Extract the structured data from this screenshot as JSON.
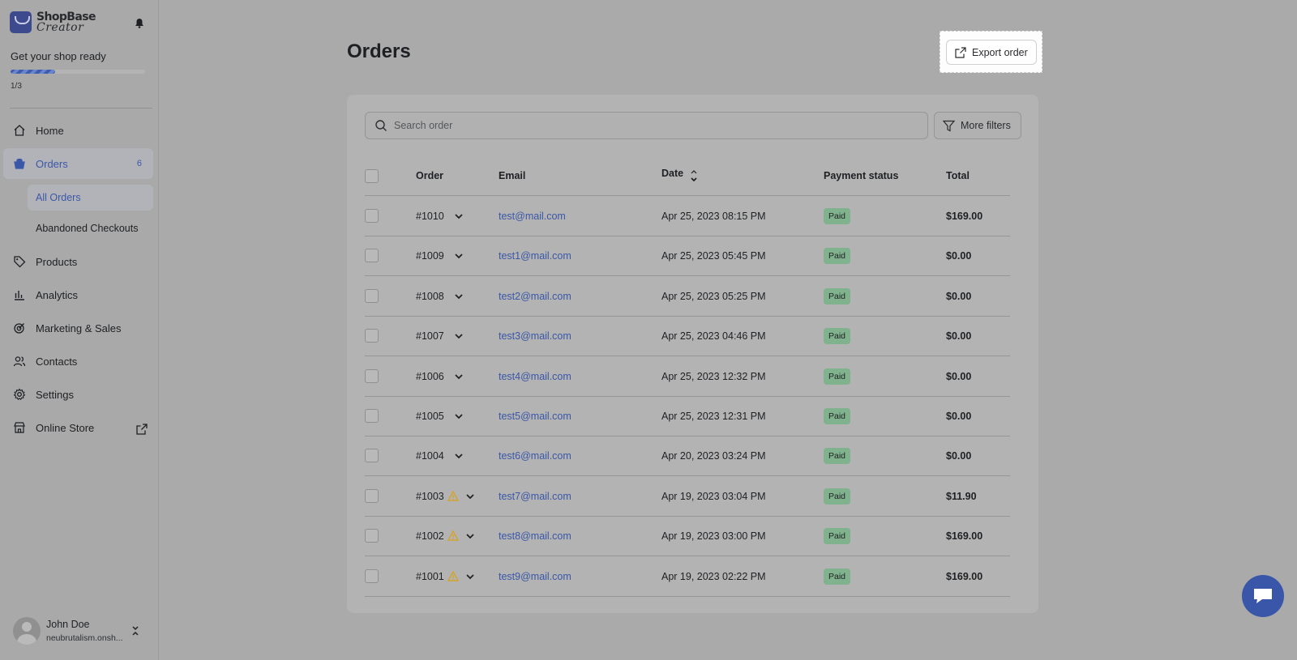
{
  "brand": {
    "line1": "ShopBase",
    "line2": "Creator"
  },
  "setup": {
    "title": "Get your shop ready",
    "progress_text": "1/3",
    "progress_fraction": 0.333
  },
  "nav": {
    "home": "Home",
    "orders": "Orders",
    "orders_badge": "6",
    "all_orders": "All Orders",
    "abandoned": "Abandoned Checkouts",
    "products": "Products",
    "analytics": "Analytics",
    "marketing": "Marketing & Sales",
    "contacts": "Contacts",
    "settings": "Settings",
    "online_store": "Online Store"
  },
  "user": {
    "name": "John Doe",
    "shop": "neubrutalism.onsh..."
  },
  "page": {
    "title": "Orders",
    "export_label": "Export order"
  },
  "search": {
    "placeholder": "Search order"
  },
  "filters": {
    "label": "More filters"
  },
  "table": {
    "headers": {
      "order": "Order",
      "email": "Email",
      "date": "Date",
      "payment": "Payment status",
      "total": "Total"
    },
    "rows": [
      {
        "order": "#1010",
        "email": "test@mail.com",
        "date": "Apr 25, 2023 08:15 PM",
        "status": "Paid",
        "total": "$169.00",
        "warning": false
      },
      {
        "order": "#1009",
        "email": "test1@mail.com",
        "date": "Apr 25, 2023 05:45 PM",
        "status": "Paid",
        "total": "$0.00",
        "warning": false
      },
      {
        "order": "#1008",
        "email": "test2@mail.com",
        "date": "Apr 25, 2023 05:25 PM",
        "status": "Paid",
        "total": "$0.00",
        "warning": false
      },
      {
        "order": "#1007",
        "email": "test3@mail.com",
        "date": "Apr 25, 2023 04:46 PM",
        "status": "Paid",
        "total": "$0.00",
        "warning": false
      },
      {
        "order": "#1006",
        "email": "test4@mail.com",
        "date": "Apr 25, 2023 12:32 PM",
        "status": "Paid",
        "total": "$0.00",
        "warning": false
      },
      {
        "order": "#1005",
        "email": "test5@mail.com",
        "date": "Apr 25, 2023 12:31 PM",
        "status": "Paid",
        "total": "$0.00",
        "warning": false
      },
      {
        "order": "#1004",
        "email": "test6@mail.com",
        "date": "Apr 20, 2023 03:24 PM",
        "status": "Paid",
        "total": "$0.00",
        "warning": false
      },
      {
        "order": "#1003",
        "email": "test7@mail.com",
        "date": "Apr 19, 2023 03:04 PM",
        "status": "Paid",
        "total": "$11.90",
        "warning": true
      },
      {
        "order": "#1002",
        "email": "test8@mail.com",
        "date": "Apr 19, 2023 03:00 PM",
        "status": "Paid",
        "total": "$169.00",
        "warning": true
      },
      {
        "order": "#1001",
        "email": "test9@mail.com",
        "date": "Apr 19, 2023 02:22 PM",
        "status": "Paid",
        "total": "$169.00",
        "warning": true
      }
    ]
  },
  "colors": {
    "accent": "#3b57a8",
    "paid_badge": "#7fb28d",
    "warning": "#d9a21b"
  }
}
